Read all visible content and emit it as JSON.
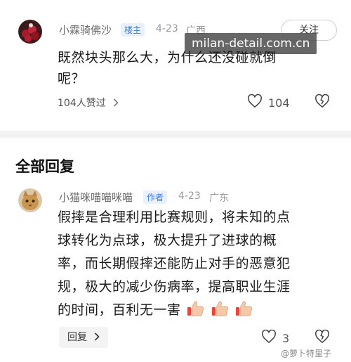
{
  "post": {
    "username": "小霖骑佛沙",
    "badge": "楼主",
    "date": "4-23",
    "location": "广西",
    "follow_label": "关注",
    "text_line1": "既然块头那么大，为什么还没碰就倒",
    "text_line2": "呢？",
    "likes_summary": "104人赞过",
    "like_count": "104"
  },
  "overlay_watermark": "milan-detail.com.cn",
  "section": {
    "title": "全部回复"
  },
  "reply": {
    "username": "小猫咪喵喵咪喵",
    "badge": "作者",
    "date": "4-23",
    "location": "广东",
    "lines": [
      "假摔是合理利用比赛规则，将未知的点",
      "球转化为点球，极大提升了进球的概",
      "率，而长期假摔还能防止对手的恶意犯",
      "规，极大的减少伤病率，提高职业生涯",
      "的时间，百利无一害"
    ],
    "reply_label": "回复",
    "like_count": "3"
  },
  "corner_watermark": "@萝卜特里子",
  "colors": {
    "badge_blue_bg": "#e8f1ff",
    "badge_blue_text": "#3c7ad8",
    "watermark_bg": "#464646"
  },
  "icons": [
    "heart-outline-icon",
    "broken-heart-icon",
    "chevron-right-icon",
    "thumbs-up-emoji"
  ]
}
